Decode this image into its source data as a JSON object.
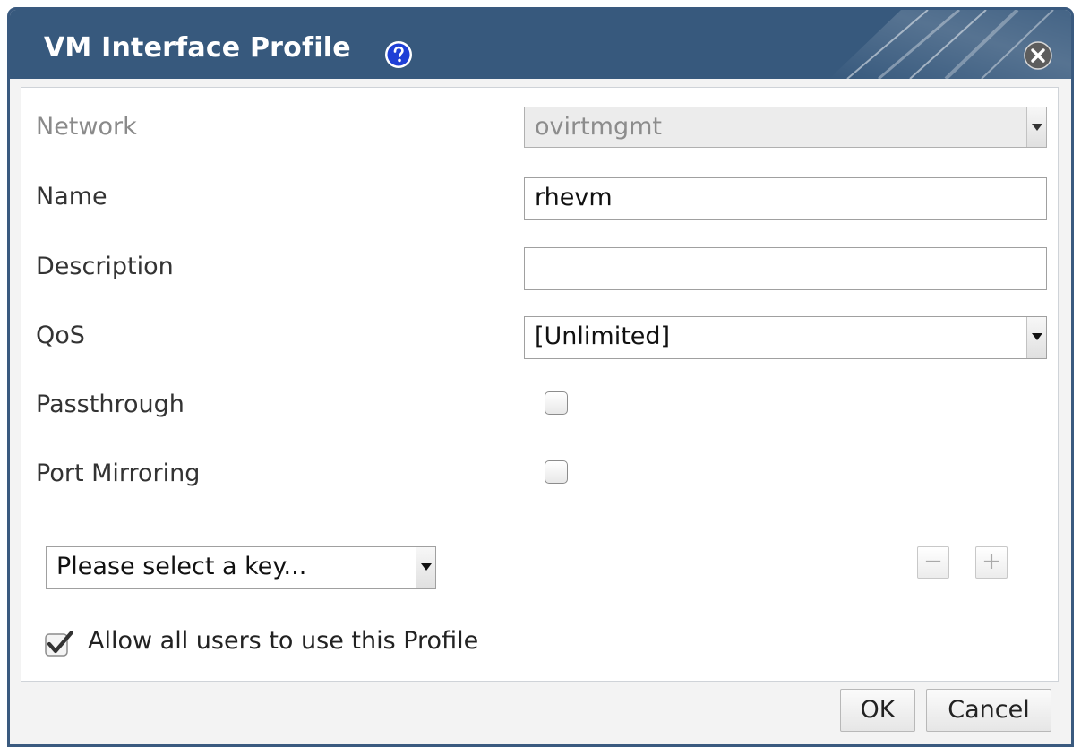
{
  "dialog": {
    "title": "VM Interface Profile",
    "accent_color": "#37597d"
  },
  "icons": {
    "help": "help-icon",
    "close": "close-icon",
    "checkmark": "checkmark-icon"
  },
  "form": {
    "network": {
      "label": "Network",
      "value": "ovirtmgmt",
      "disabled": true
    },
    "name": {
      "label": "Name",
      "value": "rhevm"
    },
    "description": {
      "label": "Description",
      "value": ""
    },
    "qos": {
      "label": "QoS",
      "value": "[Unlimited]"
    },
    "passthrough": {
      "label": "Passthrough",
      "checked": false
    },
    "port_mirroring": {
      "label": "Port Mirroring",
      "checked": false
    }
  },
  "custom_properties": {
    "key_placeholder": "Please select a key...",
    "remove_label": "−",
    "add_label": "+"
  },
  "allow_all": {
    "label": "Allow all users to use this Profile",
    "checked": true
  },
  "buttons": {
    "ok": "OK",
    "cancel": "Cancel"
  }
}
